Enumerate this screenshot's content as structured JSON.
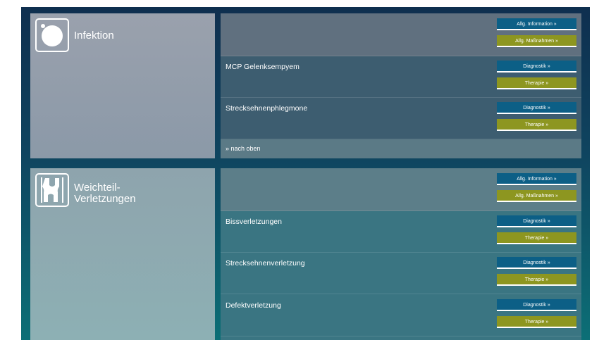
{
  "colors": {
    "blue_button": "#0c5f86",
    "olive_button": "#8d9620",
    "background_top": "#0f2f4f",
    "background_bottom": "#0c6f76"
  },
  "sections": [
    {
      "title": "Infektion",
      "icon": "infection-circle-icon",
      "top_buttons": {
        "info": "Allg. Information »",
        "measures": "Allg. Maßnahmen »"
      },
      "items": [
        {
          "label": "MCP Gelenksempyem",
          "diagnostics": "Diagnostik »",
          "therapy": "Therapie »"
        },
        {
          "label": "Strecksehnenphlegmone",
          "diagnostics": "Diagnostik »",
          "therapy": "Therapie »"
        }
      ],
      "back_to_top": "» nach oben"
    },
    {
      "title": "Weichteil-\nVerletzungen",
      "icon": "soft-tissue-joint-icon",
      "top_buttons": {
        "info": "Allg. Information »",
        "measures": "Allg. Maßnahmen »"
      },
      "items": [
        {
          "label": "Bissverletzungen",
          "diagnostics": "Diagnostik »",
          "therapy": "Therapie »"
        },
        {
          "label": "Strecksehnenverletzung",
          "diagnostics": "Diagnostik »",
          "therapy": "Therapie »"
        },
        {
          "label": "Defektverletzung",
          "diagnostics": "Diagnostik »",
          "therapy": "Therapie »"
        }
      ]
    }
  ]
}
